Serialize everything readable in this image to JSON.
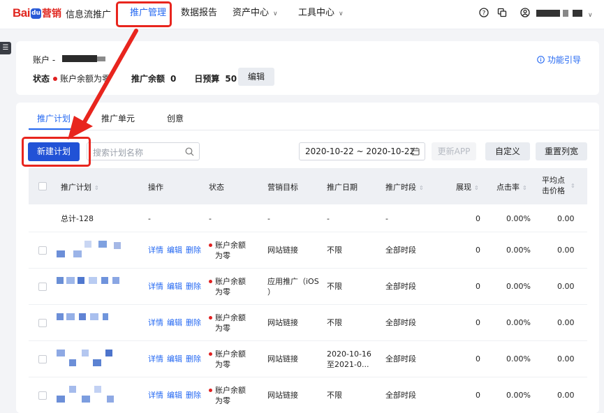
{
  "topbar": {
    "logo_text": "Bai",
    "logo_paw": "du",
    "logo_brand": "营销",
    "logo_product": "信息流推广",
    "nav": [
      {
        "label": "推广管理"
      },
      {
        "label": "数据报告"
      },
      {
        "label": "资产中心"
      },
      {
        "label": "工具中心"
      }
    ],
    "chevron": "∨",
    "icons": [
      "question-icon",
      "copy-icon",
      "user-icon"
    ]
  },
  "account": {
    "label": "账户 -",
    "status_label": "状态",
    "status_value": "账户余额为零",
    "balance_label": "推广余额",
    "balance_value": "0",
    "budget_label": "日预算",
    "budget_value": "50",
    "edit_button": "编辑",
    "guide_link": "功能引导"
  },
  "tabs": [
    {
      "label": "推广计划"
    },
    {
      "label": "推广单元"
    },
    {
      "label": "创意"
    }
  ],
  "toolbar": {
    "new_plan": "新建计划",
    "search_placeholder": "搜索计划名称",
    "date_range": "2020-10-22 ~ 2020-10-22",
    "update_app": "更新APP",
    "customize": "自定义",
    "reset_width": "重置列宽"
  },
  "table": {
    "headers": {
      "plan": "推广计划",
      "ops": "操作",
      "status": "状态",
      "goal": "营销目标",
      "date": "推广日期",
      "time": "推广时段",
      "views": "展现",
      "ctr": "点击率",
      "cpc_line1": "平均点",
      "cpc_line2": "击价格"
    },
    "total": {
      "plan": "总计-128",
      "ops": "-",
      "status": "-",
      "goal": "-",
      "date": "-",
      "time": "-",
      "views": "0",
      "ctr": "0.00%",
      "cpc": "0.00"
    },
    "ops_labels": {
      "detail": "详情",
      "edit": "编辑",
      "delete": "删除"
    },
    "rows": [
      {
        "status_1": "账户余额",
        "status_2": "为零",
        "goal_1": "网站链接",
        "goal_2": "",
        "date_1": "不限",
        "date_2": "",
        "time": "全部时段",
        "views": "0",
        "ctr": "0.00%",
        "cpc": "0.00"
      },
      {
        "status_1": "账户余额",
        "status_2": "为零",
        "goal_1": "应用推广（iOS",
        "goal_2": "）",
        "date_1": "不限",
        "date_2": "",
        "time": "全部时段",
        "views": "0",
        "ctr": "0.00%",
        "cpc": "0.00"
      },
      {
        "status_1": "账户余额",
        "status_2": "为零",
        "goal_1": "网站链接",
        "goal_2": "",
        "date_1": "不限",
        "date_2": "",
        "time": "全部时段",
        "views": "0",
        "ctr": "0.00%",
        "cpc": "0.00"
      },
      {
        "status_1": "账户余额",
        "status_2": "为零",
        "goal_1": "网站链接",
        "goal_2": "",
        "date_1": "2020-10-16",
        "date_2": "至2021-0...",
        "time": "全部时段",
        "views": "0",
        "ctr": "0.00%",
        "cpc": "0.00"
      },
      {
        "status_1": "账户余额",
        "status_2": "为零",
        "goal_1": "网站链接",
        "goal_2": "",
        "date_1": "不限",
        "date_2": "",
        "time": "全部时段",
        "views": "0",
        "ctr": "0.00%",
        "cpc": "0.00"
      }
    ]
  },
  "colors": {
    "accent": "#2468f2",
    "primary_button": "#2152d6",
    "highlight_box": "#e8251e",
    "status_dot": "#e02020"
  }
}
